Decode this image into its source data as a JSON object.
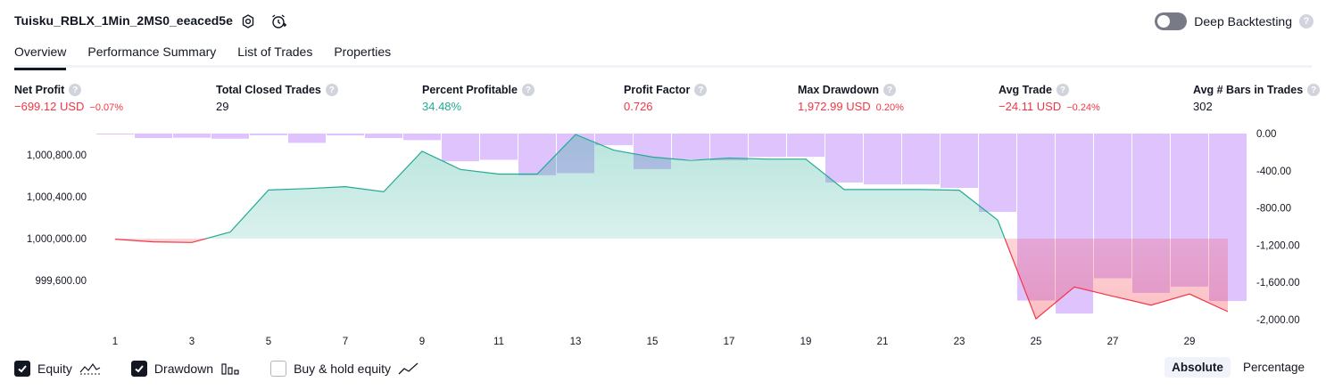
{
  "header": {
    "strategy_name": "Tuisku_RBLX_1Min_2MS0_eeaced5e",
    "settings_icon": "gear-icon",
    "alert_icon": "alarm-clock-icon",
    "deep_backtesting_label": "Deep Backtesting",
    "deep_backtesting_on": false,
    "help_glyph": "?"
  },
  "tabs": [
    {
      "label": "Overview",
      "active": true
    },
    {
      "label": "Performance Summary",
      "active": false
    },
    {
      "label": "List of Trades",
      "active": false
    },
    {
      "label": "Properties",
      "active": false
    }
  ],
  "metrics": [
    {
      "label": "Net Profit",
      "value": "−699.12 USD",
      "pct": "−0.07%",
      "tone": "neg"
    },
    {
      "label": "Total Closed Trades",
      "value": "29",
      "pct": "",
      "tone": "neu"
    },
    {
      "label": "Percent Profitable",
      "value": "34.48%",
      "pct": "",
      "tone": "pos"
    },
    {
      "label": "Profit Factor",
      "value": "0.726",
      "pct": "",
      "tone": "neg"
    },
    {
      "label": "Max Drawdown",
      "value": "1,972.99 USD",
      "pct": "0.20%",
      "tone": "neg"
    },
    {
      "label": "Avg Trade",
      "value": "−24.11 USD",
      "pct": "−0.24%",
      "tone": "neg"
    },
    {
      "label": "Avg # Bars in Trades",
      "value": "302",
      "pct": "",
      "tone": "neu"
    }
  ],
  "chart_data": {
    "type": "line",
    "x_ticks": [
      "1",
      "3",
      "5",
      "7",
      "9",
      "11",
      "13",
      "15",
      "17",
      "19",
      "21",
      "23",
      "25",
      "27",
      "29"
    ],
    "left_axis_ticks": [
      "1,000,800.00",
      "1,000,400.00",
      "1,000,000.00",
      "999,600.00"
    ],
    "right_axis_ticks": [
      "0.00",
      "-400.00",
      "-800.00",
      "-1,200.00",
      "-1,600.00",
      "-2,000.00"
    ],
    "equity": {
      "baseline": 1000000,
      "x": [
        1,
        2,
        3,
        4,
        5,
        6,
        7,
        8,
        9,
        10,
        11,
        12,
        13,
        14,
        15,
        16,
        17,
        18,
        19,
        20,
        21,
        22,
        23,
        24,
        25,
        26,
        27,
        28,
        29,
        30
      ],
      "values": [
        999995,
        999969,
        999963,
        1000063,
        1000465,
        1000478,
        1000497,
        1000448,
        1000836,
        1000661,
        1000617,
        1000617,
        1000995,
        1000845,
        1000780,
        1000747,
        1000770,
        1000760,
        1000760,
        1000469,
        1000469,
        1000469,
        1000463,
        1000178,
        999233,
        999538,
        999449,
        999364,
        999471,
        999302
      ]
    },
    "drawdown": {
      "x": [
        1,
        2,
        3,
        4,
        5,
        6,
        7,
        8,
        9,
        10,
        11,
        12,
        13,
        14,
        15,
        16,
        17,
        18,
        19,
        20,
        21,
        22,
        23,
        24,
        25,
        26,
        27,
        28,
        29,
        30
      ],
      "values": [
        -4,
        -48,
        -45,
        -55,
        -18,
        -100,
        -20,
        -48,
        -70,
        -298,
        -282,
        -448,
        -425,
        -125,
        -382,
        -277,
        -288,
        -252,
        -250,
        -526,
        -546,
        -546,
        -584,
        -842,
        -1795,
        -1935,
        -1555,
        -1712,
        -1645,
        -1800
      ]
    },
    "equity_colors": {
      "above": "#22ab94",
      "below": "#f23645"
    },
    "drawdown_color": "#d9b8fb",
    "buy_hold_shown": false
  },
  "legend": [
    {
      "label": "Equity",
      "checked": true,
      "icon": "equity-line-icon"
    },
    {
      "label": "Drawdown",
      "checked": true,
      "icon": "drawdown-bars-icon"
    },
    {
      "label": "Buy & hold equity",
      "checked": false,
      "icon": "buy-hold-line-icon"
    }
  ],
  "modes": [
    {
      "label": "Absolute",
      "active": true
    },
    {
      "label": "Percentage",
      "active": false
    }
  ]
}
